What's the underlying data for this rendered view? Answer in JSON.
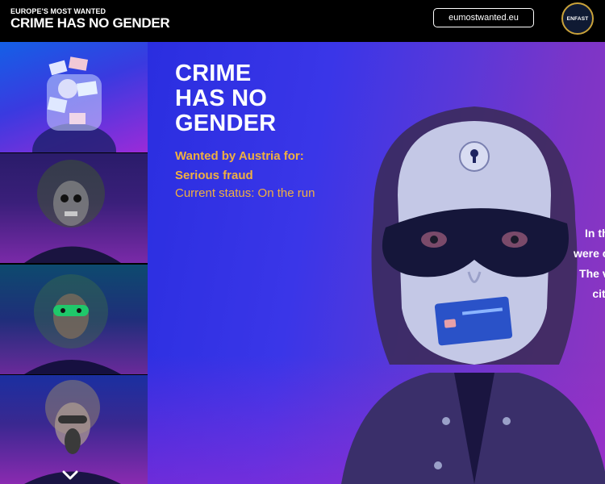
{
  "header": {
    "brand_sub": "EUROPE'S MOST WANTED",
    "brand_title": "CRIME HAS NO GENDER",
    "site_button": "eumostwanted.eu",
    "logo_text": "ENFAST"
  },
  "sidebar": {
    "thumbnails": [
      {
        "icon": "money-collage-portrait"
      },
      {
        "icon": "skull-mask-portrait"
      },
      {
        "icon": "green-mask-portrait"
      },
      {
        "icon": "gas-mask-portrait"
      }
    ],
    "scroll_icon": "chevron-down-icon"
  },
  "hero": {
    "title_lines": [
      "CRIME",
      "HAS NO",
      "GENDER"
    ],
    "wanted_lines": [
      "Wanted by Austria for:",
      "Serious fraud"
    ],
    "status": "Current status: On the run",
    "side_text": [
      "In th",
      "were c",
      "The v",
      "citi"
    ],
    "accent_color": "#f0b040"
  }
}
